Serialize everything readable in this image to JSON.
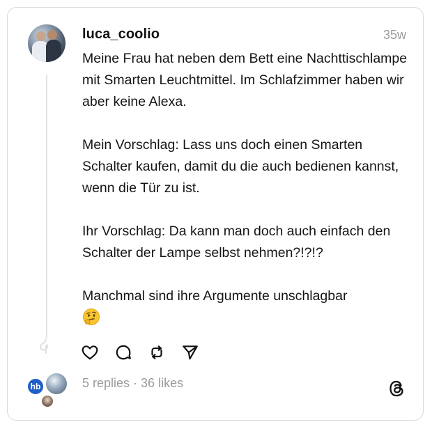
{
  "post": {
    "username": "luca_coolio",
    "time": "35w",
    "paragraphs": [
      "Meine Frau hat neben dem Bett eine Nachttischlampe mit Smarten Leuchtmittel. Im Schlafzimmer haben wir aber keine Alexa.",
      "Mein Vorschlag: Lass uns doch einen Smarten Schalter kaufen, damit du die auch bedienen kannst, wenn die Tür zu ist.",
      "Ihr Vorschlag: Da kann man doch auch einfach den Schalter der Lampe selbst nehmen?!?!?",
      "Manchmal sind ihre Argumente unschlagbar"
    ],
    "emoji": "thinking-face"
  },
  "stats": {
    "replies": "5 replies",
    "separator": "·",
    "likes": "36 likes"
  },
  "replier_badge": "hb",
  "icons": {
    "like": "heart-icon",
    "comment": "comment-icon",
    "repost": "repost-icon",
    "share": "send-icon",
    "brand": "threads-logo-icon"
  }
}
